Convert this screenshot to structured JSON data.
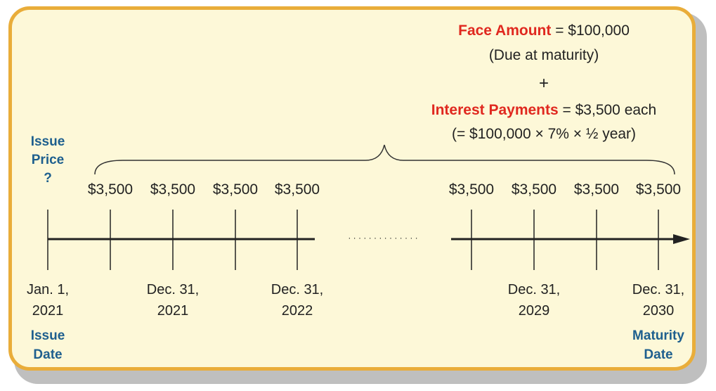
{
  "colors": {
    "border": "#e9ad3a",
    "background": "#fdf8d8",
    "highlight_red": "#e0281f",
    "label_blue": "#1e5f8e"
  },
  "top_box": {
    "face_label": "Face Amount",
    "face_value": "= $100,000",
    "face_note": "(Due at maturity)",
    "plus": "+",
    "interest_label": "Interest Payments",
    "interest_value": "= $3,500 each",
    "interest_formula": "(= $100,000 × 7% × ½ year)"
  },
  "issue_price": {
    "line1": "Issue",
    "line2": "Price",
    "line3": "?"
  },
  "payments": [
    "$3,500",
    "$3,500",
    "$3,500",
    "$3,500",
    "$3,500",
    "$3,500",
    "$3,500",
    "$3,500"
  ],
  "dots": "· · · · · · · · · · · · · ·",
  "dates": [
    {
      "line1": "Jan. 1,",
      "line2": "2021"
    },
    {
      "line1": "Dec. 31,",
      "line2": "2021"
    },
    {
      "line1": "Dec. 31,",
      "line2": "2022"
    },
    {
      "line1": "Dec. 31,",
      "line2": "2029"
    },
    {
      "line1": "Dec. 31,",
      "line2": "2030"
    }
  ],
  "issue_date": {
    "line1": "Issue",
    "line2": "Date"
  },
  "maturity_date": {
    "line1": "Maturity",
    "line2": "Date"
  }
}
